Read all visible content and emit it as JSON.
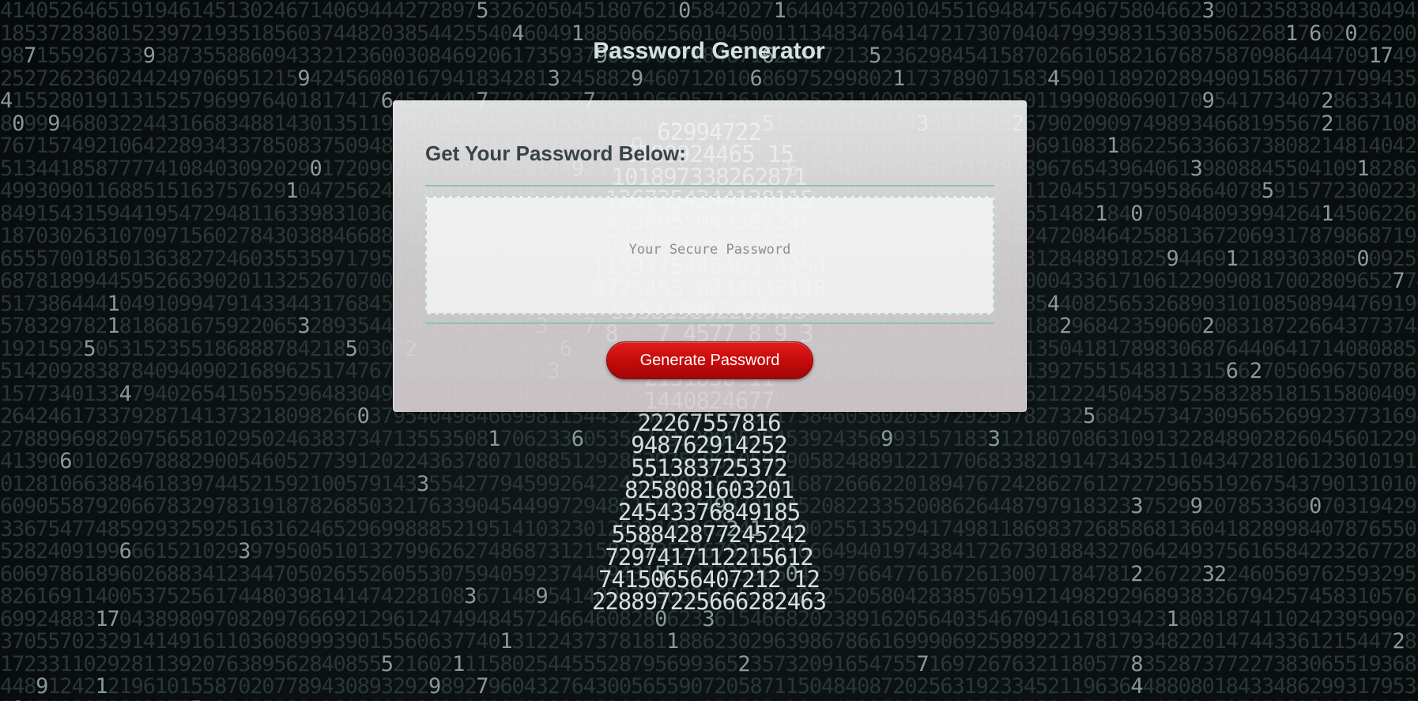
{
  "page": {
    "title": "Password Generator"
  },
  "card": {
    "header": "Get Your Password Below:",
    "password_placeholder": "Your Secure Password",
    "password_value": "",
    "generate_button_label": "Generate Password"
  },
  "background": {
    "description_colors": {
      "base": "#0b1011",
      "digits_dim": "#2b3638",
      "digits_bright": "#d6dfe0"
    },
    "figure_lines": [
      "62994722",
      "0188924465 15",
      "101897338262871",
      "1267354344128115",
      "4538855049382246",
      "85515 0 09 33536",
      "1153775446403 4254",
      "9725455 0244832148",
      "555815892288455",
      "8   7 4577 8 9 3",
      "58484237",
      "2151850 11",
      "1440824677",
      "22267557816",
      "948762914252",
      "551383725372",
      "8258081603201",
      "24543376849185",
      "558842877245242",
      "7297417112215612",
      "74150656407212 12",
      "228897225666282463"
    ]
  },
  "accent": {
    "button_red": "#c40a0a",
    "divider_teal": "#8fc2b8",
    "title_color": "#d4e2e4"
  }
}
